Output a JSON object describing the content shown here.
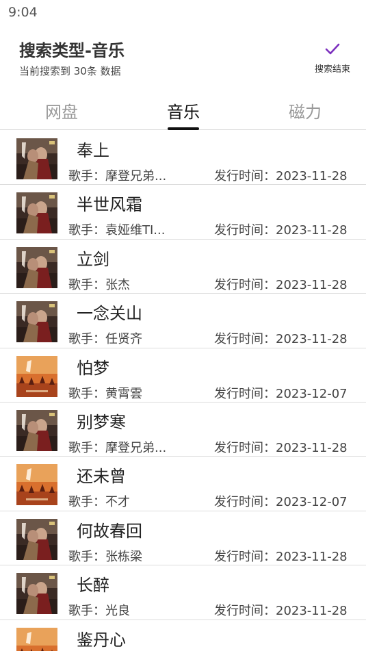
{
  "status": {
    "time": "9:04"
  },
  "header": {
    "title": "搜索类型-音乐",
    "subtitle": "当前搜索到 30条 数据",
    "finish_label": "搜索结束",
    "accent_color": "#7b2fbe"
  },
  "tabs": [
    {
      "label": "网盘",
      "active": false
    },
    {
      "label": "音乐",
      "active": true
    },
    {
      "label": "磁力",
      "active": false
    }
  ],
  "songs": [
    {
      "title": "奉上",
      "artist": "歌手：摩登兄弟...",
      "release": "发行时间：2023-11-28",
      "cover": "dark-romance"
    },
    {
      "title": "半世风霜",
      "artist": "歌手：袁娅维TI...",
      "release": "发行时间：2023-11-28",
      "cover": "dark-romance"
    },
    {
      "title": "立剑",
      "artist": "歌手：张杰",
      "release": "发行时间：2023-11-28",
      "cover": "dark-romance"
    },
    {
      "title": "一念关山",
      "artist": "歌手：任贤齐",
      "release": "发行时间：2023-11-28",
      "cover": "dark-romance"
    },
    {
      "title": "怕梦",
      "artist": "歌手：黄霄雲",
      "release": "发行时间：2023-12-07",
      "cover": "orange-desert"
    },
    {
      "title": "别梦寒",
      "artist": "歌手：摩登兄弟...",
      "release": "发行时间：2023-11-28",
      "cover": "dark-romance"
    },
    {
      "title": "还未曾",
      "artist": "歌手：不才",
      "release": "发行时间：2023-12-07",
      "cover": "orange-desert"
    },
    {
      "title": "何故春回",
      "artist": "歌手：张栋梁",
      "release": "发行时间：2023-11-28",
      "cover": "dark-romance"
    },
    {
      "title": "长醉",
      "artist": "歌手：光良",
      "release": "发行时间：2023-11-28",
      "cover": "dark-romance"
    },
    {
      "title": "鉴丹心",
      "artist": "",
      "release": "",
      "cover": "orange-desert"
    }
  ]
}
